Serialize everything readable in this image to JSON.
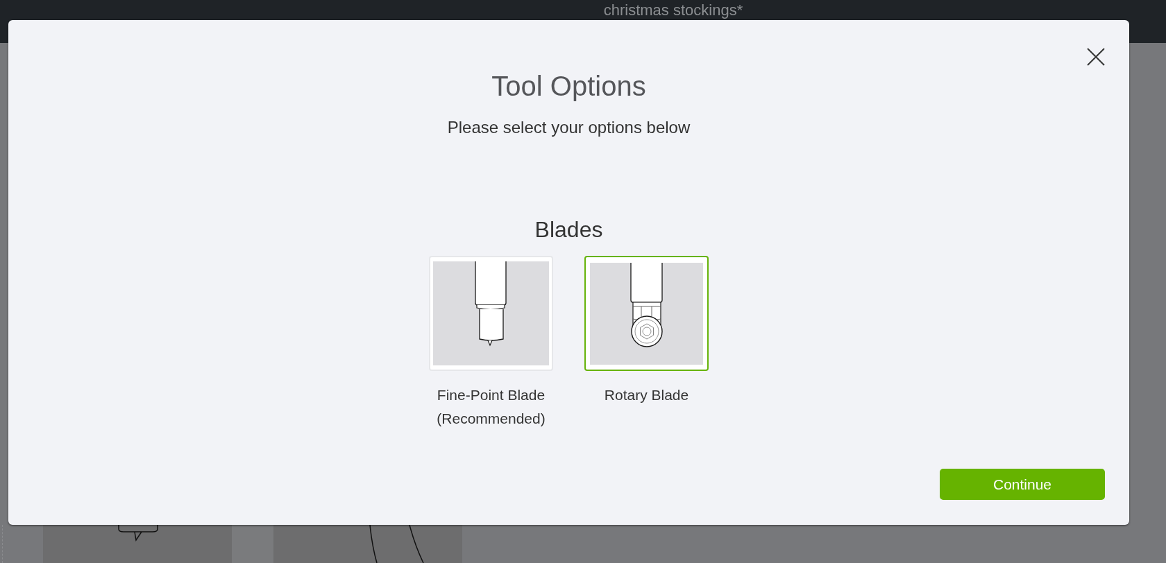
{
  "app": {
    "document_title": "christmas stockings*"
  },
  "dialog": {
    "title": "Tool Options",
    "subtitle": "Please select your options below",
    "section_title": "Blades",
    "options": [
      {
        "kind": "fine_point",
        "label": "Fine-Point Blade (Recommended)",
        "selected": false
      },
      {
        "kind": "rotary",
        "label": "Rotary Blade",
        "selected": true
      }
    ],
    "primary_button": "Continue"
  }
}
